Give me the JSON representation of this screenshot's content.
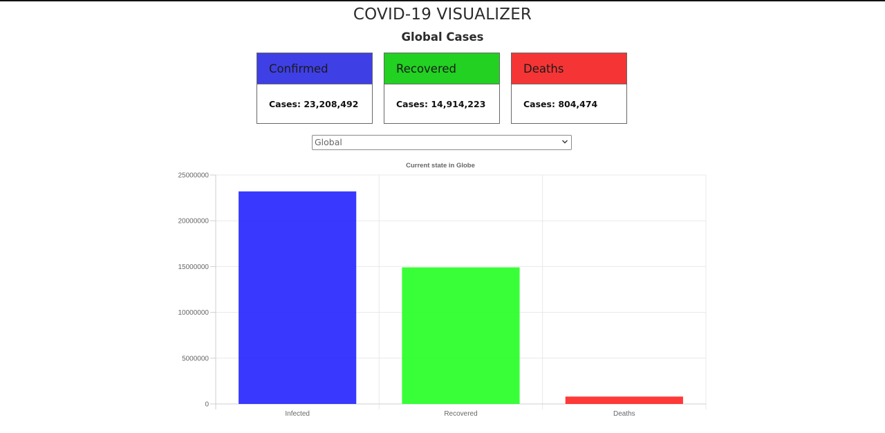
{
  "header": {
    "title": "COVID-19 VISUALIZER",
    "subtitle": "Global Cases"
  },
  "cards": [
    {
      "title": "Confirmed",
      "value_text": "Cases: 23,208,492",
      "color": "#3f3fe6"
    },
    {
      "title": "Recovered",
      "value_text": "Cases: 14,914,223",
      "color": "#22d122"
    },
    {
      "title": "Deaths",
      "value_text": "Cases: 804,474",
      "color": "#f53535"
    }
  ],
  "region_select": {
    "selected": "Global"
  },
  "chart_data": {
    "type": "bar",
    "title": "Current state in Globe",
    "categories": [
      "Infected",
      "Recovered",
      "Deaths"
    ],
    "values": [
      23208492,
      14914223,
      804474
    ],
    "colors": [
      "#2222ff",
      "#22ff22",
      "#ff2222"
    ],
    "ylim": [
      0,
      25000000
    ],
    "yticks": [
      "0",
      "5000000",
      "10000000",
      "15000000",
      "20000000",
      "25000000"
    ],
    "grid": true,
    "legend": "none"
  }
}
